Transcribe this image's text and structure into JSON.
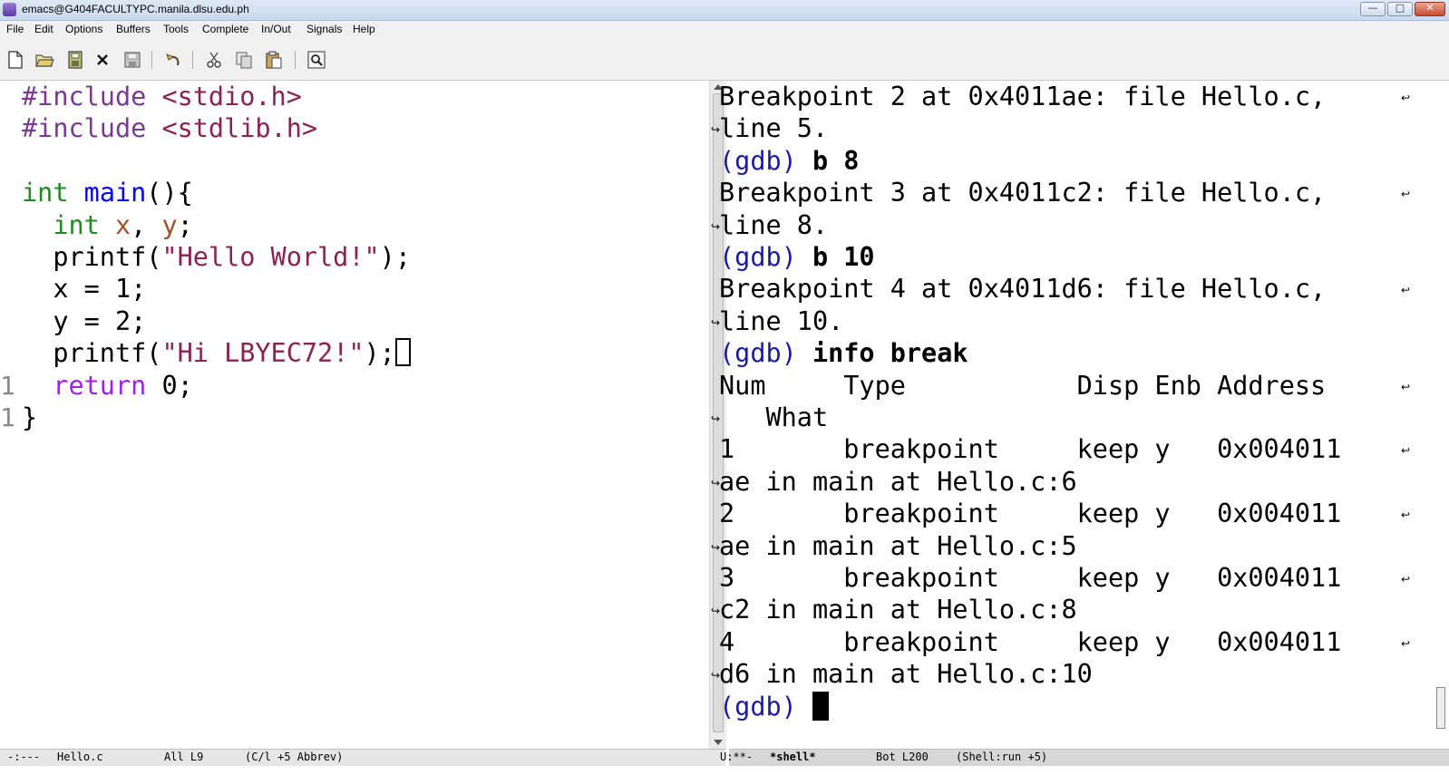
{
  "window": {
    "title": "emacs@G404FACULTYPC.manila.dlsu.edu.ph",
    "min_label": "—",
    "max_label": "□",
    "close_label": "✕"
  },
  "menu": {
    "items": [
      "File",
      "Edit",
      "Options",
      "Buffers",
      "Tools",
      "Complete",
      "In/Out",
      "Signals",
      "Help"
    ]
  },
  "toolbar": {
    "icons": [
      "new-file-icon",
      "open-folder-icon",
      "save-buffer-icon",
      "close-buffer-icon",
      "save-icon",
      "undo-icon",
      "cut-icon",
      "copy-icon",
      "paste-icon",
      "search-icon"
    ]
  },
  "editor": {
    "gutter": [
      "1",
      "1"
    ],
    "lines": [
      {
        "parts": [
          [
            "pp",
            "#include "
          ],
          [
            "str",
            "<stdio.h>"
          ]
        ]
      },
      {
        "parts": [
          [
            "pp",
            "#include "
          ],
          [
            "str",
            "<stdlib.h>"
          ]
        ]
      },
      {
        "parts": []
      },
      {
        "parts": [
          [
            "type",
            "int"
          ],
          [
            "plain",
            " "
          ],
          [
            "fn",
            "main"
          ],
          [
            "plain",
            "(){"
          ]
        ]
      },
      {
        "parts": [
          [
            "plain",
            "  "
          ],
          [
            "type",
            "int"
          ],
          [
            "plain",
            " "
          ],
          [
            "var",
            "x"
          ],
          [
            "plain",
            ", "
          ],
          [
            "var",
            "y"
          ],
          [
            "plain",
            ";"
          ]
        ]
      },
      {
        "parts": [
          [
            "plain",
            "  printf("
          ],
          [
            "str",
            "\"Hello World!\""
          ],
          [
            "plain",
            ");"
          ]
        ]
      },
      {
        "parts": [
          [
            "plain",
            "  x = 1;"
          ]
        ]
      },
      {
        "parts": [
          [
            "plain",
            "  y = 2;"
          ]
        ]
      },
      {
        "parts": [
          [
            "plain",
            "  printf("
          ],
          [
            "str",
            "\"Hi LBYEC72!\""
          ],
          [
            "plain",
            ");"
          ],
          [
            "cursor",
            ""
          ]
        ]
      },
      {
        "parts": [
          [
            "plain",
            "  "
          ],
          [
            "ret",
            "return"
          ],
          [
            "plain",
            " 0;"
          ]
        ]
      },
      {
        "parts": [
          [
            "plain",
            "}"
          ]
        ]
      }
    ]
  },
  "shell": {
    "lines": [
      {
        "parts": [
          [
            "plain",
            "Breakpoint 2 at 0x4011ae: file Hello.c,"
          ]
        ],
        "wrap_end": true
      },
      {
        "parts": [
          [
            "plain",
            "line 5."
          ]
        ],
        "wrap_start": true
      },
      {
        "parts": [
          [
            "prompt",
            "(gdb) "
          ],
          [
            "bold",
            "b 8"
          ]
        ]
      },
      {
        "parts": [
          [
            "plain",
            "Breakpoint 3 at 0x4011c2: file Hello.c,"
          ]
        ],
        "wrap_end": true
      },
      {
        "parts": [
          [
            "plain",
            "line 8."
          ]
        ],
        "wrap_start": true
      },
      {
        "parts": [
          [
            "prompt",
            "(gdb) "
          ],
          [
            "bold",
            "b 10"
          ]
        ]
      },
      {
        "parts": [
          [
            "plain",
            "Breakpoint 4 at 0x4011d6: file Hello.c,"
          ]
        ],
        "wrap_end": true
      },
      {
        "parts": [
          [
            "plain",
            "line 10."
          ]
        ],
        "wrap_start": true
      },
      {
        "parts": [
          [
            "prompt",
            "(gdb) "
          ],
          [
            "bold",
            "info break"
          ]
        ]
      },
      {
        "parts": [
          [
            "plain",
            "Num     Type           Disp Enb Address"
          ]
        ],
        "wrap_end": true
      },
      {
        "parts": [
          [
            "plain",
            "   What"
          ]
        ],
        "wrap_start": true
      },
      {
        "parts": [
          [
            "plain",
            "1       breakpoint     keep y   0x004011"
          ]
        ],
        "wrap_end": true
      },
      {
        "parts": [
          [
            "plain",
            "ae in main at Hello.c:6"
          ]
        ],
        "wrap_start": true
      },
      {
        "parts": [
          [
            "plain",
            "2       breakpoint     keep y   0x004011"
          ]
        ],
        "wrap_end": true
      },
      {
        "parts": [
          [
            "plain",
            "ae in main at Hello.c:5"
          ]
        ],
        "wrap_start": true
      },
      {
        "parts": [
          [
            "plain",
            "3       breakpoint     keep y   0x004011"
          ]
        ],
        "wrap_end": true
      },
      {
        "parts": [
          [
            "plain",
            "c2 in main at Hello.c:8"
          ]
        ],
        "wrap_start": true
      },
      {
        "parts": [
          [
            "plain",
            "4       breakpoint     keep y   0x004011"
          ]
        ],
        "wrap_end": true
      },
      {
        "parts": [
          [
            "plain",
            "d6 in main at Hello.c:10"
          ]
        ],
        "wrap_start": true
      },
      {
        "parts": [
          [
            "prompt",
            "(gdb) "
          ],
          [
            "cursorfill",
            ""
          ]
        ]
      }
    ]
  },
  "modeline_left": {
    "status": "-:---",
    "buffer": "Hello.c",
    "position": "All L9",
    "mode": "(C/l +5 Abbrev)"
  },
  "modeline_right": {
    "status": "U:**-",
    "buffer": "*shell*",
    "position": "Bot L200",
    "mode": "(Shell:run +5)"
  }
}
